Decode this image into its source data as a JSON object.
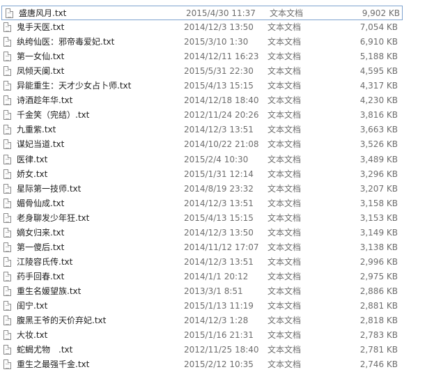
{
  "icons": {
    "file": "text-file-icon"
  },
  "files": [
    {
      "name": "盛唐风月.txt",
      "date": "2015/4/30 11:37",
      "type": "文本文档",
      "size": "9,902 KB"
    },
    {
      "name": "鬼手天医.txt",
      "date": "2014/12/3 13:50",
      "type": "文本文档",
      "size": "7,054 KB"
    },
    {
      "name": "纨绔仙医：邪帝毒爱妃.txt",
      "date": "2015/3/10 1:30",
      "type": "文本文档",
      "size": "6,910 KB"
    },
    {
      "name": "第一女仙.txt",
      "date": "2014/12/11 16:23",
      "type": "文本文档",
      "size": "5,188 KB"
    },
    {
      "name": "凤倾天阑.txt",
      "date": "2015/5/31 22:30",
      "type": "文本文档",
      "size": "4,595 KB"
    },
    {
      "name": "异能重生：天才少女占卜师.txt",
      "date": "2015/4/13 15:15",
      "type": "文本文档",
      "size": "4,317 KB"
    },
    {
      "name": "诗酒趁年华.txt",
      "date": "2014/12/18 18:40",
      "type": "文本文档",
      "size": "4,230 KB"
    },
    {
      "name": "千金笑（完结）.txt",
      "date": "2012/11/24 20:26",
      "type": "文本文档",
      "size": "3,816 KB"
    },
    {
      "name": "九重紫.txt",
      "date": "2014/12/3 13:51",
      "type": "文本文档",
      "size": "3,663 KB"
    },
    {
      "name": "谋妃当道.txt",
      "date": "2014/10/22 21:08",
      "type": "文本文档",
      "size": "3,526 KB"
    },
    {
      "name": "医律.txt",
      "date": "2015/2/4 10:30",
      "type": "文本文档",
      "size": "3,489 KB"
    },
    {
      "name": "娇女.txt",
      "date": "2015/1/31 12:14",
      "type": "文本文档",
      "size": "3,296 KB"
    },
    {
      "name": "星际第一技师.txt",
      "date": "2014/8/19 23:32",
      "type": "文本文档",
      "size": "3,207 KB"
    },
    {
      "name": "媚骨仙成.txt",
      "date": "2014/12/3 13:51",
      "type": "文本文档",
      "size": "3,158 KB"
    },
    {
      "name": "老身聊发少年狂.txt",
      "date": "2015/4/13 15:15",
      "type": "文本文档",
      "size": "3,153 KB"
    },
    {
      "name": "嫡女归来.txt",
      "date": "2014/12/3 13:50",
      "type": "文本文档",
      "size": "3,149 KB"
    },
    {
      "name": "第一傻后.txt",
      "date": "2014/11/12 17:07",
      "type": "文本文档",
      "size": "3,138 KB"
    },
    {
      "name": "江陵容氏传.txt",
      "date": "2014/12/3 13:51",
      "type": "文本文档",
      "size": "2,996 KB"
    },
    {
      "name": "药手回春.txt",
      "date": "2014/1/1 20:12",
      "type": "文本文档",
      "size": "2,975 KB"
    },
    {
      "name": "重生名媛望族.txt",
      "date": "2013/3/1 8:51",
      "type": "文本文档",
      "size": "2,886 KB"
    },
    {
      "name": "闺宁.txt",
      "date": "2015/1/13 11:19",
      "type": "文本文档",
      "size": "2,881 KB"
    },
    {
      "name": "腹黑王爷的天价弃妃.txt",
      "date": "2014/12/3 1:28",
      "type": "文本文档",
      "size": "2,818 KB"
    },
    {
      "name": "大妆.txt",
      "date": "2015/1/16 21:31",
      "type": "文本文档",
      "size": "2,783 KB"
    },
    {
      "name": "蛇蝎尤物　.txt",
      "date": "2012/11/25 18:40",
      "type": "文本文档",
      "size": "2,781 KB"
    },
    {
      "name": "重生之最强千金.txt",
      "date": "2015/2/12 10:35",
      "type": "文本文档",
      "size": "2,746 KB"
    }
  ]
}
